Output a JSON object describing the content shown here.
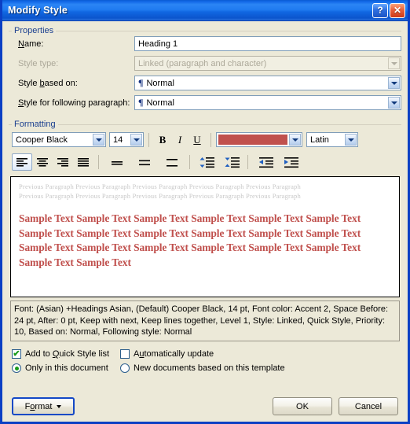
{
  "window": {
    "title": "Modify Style",
    "help_label": "?",
    "close_label": "✕"
  },
  "properties": {
    "legend": "Properties",
    "name_label": "Name:",
    "name_value": "Heading 1",
    "style_type_label": "Style type:",
    "style_type_value": "Linked (paragraph and character)",
    "based_on_label": "Style based on:",
    "based_on_value": "Normal",
    "following_label": "Style for following paragraph:",
    "following_value": "Normal",
    "pilcrow": "¶"
  },
  "formatting": {
    "legend": "Formatting",
    "font_family": "Cooper Black",
    "font_size": "14",
    "bold_label": "B",
    "italic_label": "I",
    "underline_label": "U",
    "font_color": "#c0504d",
    "script": "Latin",
    "align_left": "align-left",
    "align_center": "align-center",
    "align_right": "align-right",
    "align_justify": "align-justify",
    "line_spacing_single": "line-spacing-single",
    "line_spacing_1_5": "line-spacing-1.5",
    "line_spacing_double": "line-spacing-double",
    "space_before": "decrease-paragraph-spacing",
    "space_after": "increase-paragraph-spacing",
    "indent_decrease": "decrease-indent",
    "indent_increase": "increase-indent"
  },
  "preview": {
    "previous_paragraph_line1": "Previous Paragraph Previous Paragraph Previous Paragraph Previous Paragraph Previous Paragraph",
    "previous_paragraph_line2": "Previous Paragraph Previous Paragraph Previous Paragraph Previous Paragraph Previous Paragraph",
    "sample_text": "Sample Text Sample Text Sample Text Sample Text Sample Text Sample Text Sample Text Sample Text Sample Text Sample Text Sample Text Sample Text Sample Text Sample Text Sample Text Sample Text Sample Text Sample Text Sample Text Sample Text"
  },
  "description": "Font: (Asian) +Headings Asian, (Default) Cooper Black, 14 pt, Font color: Accent 2, Space Before: 24 pt, After:  0 pt, Keep with next, Keep lines together, Level 1, Style: Linked, Quick Style, Priority: 10, Based on: Normal, Following style: Normal",
  "options": {
    "add_to_quick_style": "Add to Quick Style list",
    "add_to_quick_style_checked": true,
    "automatically_update": "Automatically update",
    "automatically_update_checked": false,
    "only_this_document": "Only in this document",
    "only_this_document_selected": true,
    "new_documents_template": "New documents based on this template",
    "new_documents_template_selected": false,
    "check_mark": "✔"
  },
  "footer": {
    "format_label": "Format",
    "ok_label": "OK",
    "cancel_label": "Cancel"
  }
}
